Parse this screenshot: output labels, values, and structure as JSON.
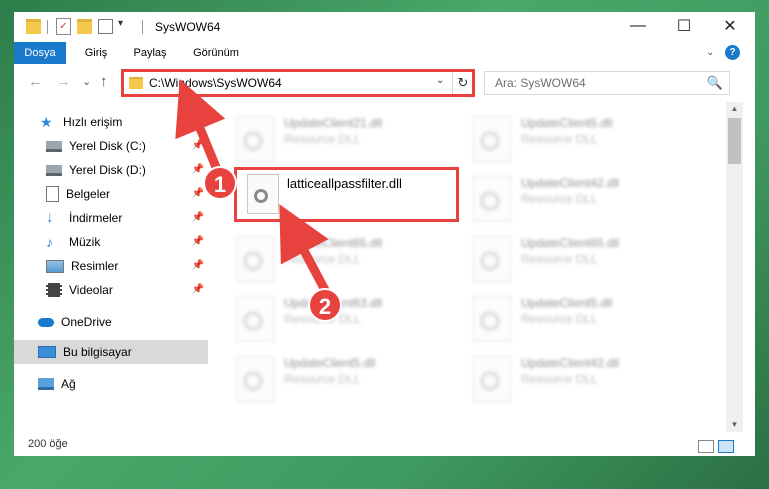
{
  "window": {
    "title": "SysWOW64",
    "controls": {
      "minimize": "—",
      "maximize": "☐",
      "close": "✕"
    }
  },
  "ribbon": {
    "tabs": [
      {
        "label": "Dosya",
        "active": true
      },
      {
        "label": "Giriş",
        "active": false
      },
      {
        "label": "Paylaş",
        "active": false
      },
      {
        "label": "Görünüm",
        "active": false
      }
    ],
    "help_icon": "?"
  },
  "address_bar": {
    "path": "C:\\Windows\\SysWOW64",
    "refresh_icon": "↻",
    "dropdown_icon": "⌄"
  },
  "search": {
    "placeholder": "Ara: SysWOW64",
    "icon": "🔍"
  },
  "navigation": {
    "back": "←",
    "forward": "→",
    "recent": "⌄",
    "up": "↑",
    "items": [
      {
        "label": "Hızlı erişim",
        "icon": "star-icon",
        "pinned": false
      },
      {
        "label": "Yerel Disk (C:)",
        "icon": "drive-icon",
        "pinned": true
      },
      {
        "label": "Yerel Disk (D:)",
        "icon": "drive-icon",
        "pinned": true
      },
      {
        "label": "Belgeler",
        "icon": "documents-icon",
        "pinned": true
      },
      {
        "label": "İndirmeler",
        "icon": "download-icon",
        "pinned": true
      },
      {
        "label": "Müzik",
        "icon": "music-icon",
        "pinned": true
      },
      {
        "label": "Resimler",
        "icon": "pictures-icon",
        "pinned": true
      },
      {
        "label": "Videolar",
        "icon": "videos-icon",
        "pinned": true
      },
      {
        "label": "OneDrive",
        "icon": "cloud-icon",
        "pinned": false
      },
      {
        "label": "Bu bilgisayar",
        "icon": "computer-icon",
        "pinned": false,
        "selected": true
      },
      {
        "label": "Ağ",
        "icon": "network-icon",
        "pinned": false
      }
    ]
  },
  "files": {
    "highlighted": {
      "name": "latticeallpassfilter.dll"
    },
    "blurred_left": [
      {
        "name": "UpdateClient21.dll",
        "type": "Resource DLL"
      },
      {
        "name": "UpdateClient65.dll",
        "type": "Resource DLL"
      },
      {
        "name": "UpdateClient63.dll",
        "type": "Resource DLL"
      },
      {
        "name": "UpdateClient5.dll",
        "type": "Resource DLL"
      }
    ],
    "blurred_right": [
      {
        "name": "UpdateClient5.dll",
        "type": "Resource DLL"
      },
      {
        "name": "UpdateClient42.dll",
        "type": "Resource DLL"
      },
      {
        "name": "UpdateClient65.dll",
        "type": "Resource DLL"
      },
      {
        "name": "UpdateClient5.dll",
        "type": "Resource DLL"
      },
      {
        "name": "UpdateClient42.dll",
        "type": "Resource DLL"
      }
    ]
  },
  "status_bar": {
    "item_count": "200 öğe"
  },
  "annotations": {
    "step1": "1",
    "step2": "2",
    "accent_color": "#e8423e"
  }
}
